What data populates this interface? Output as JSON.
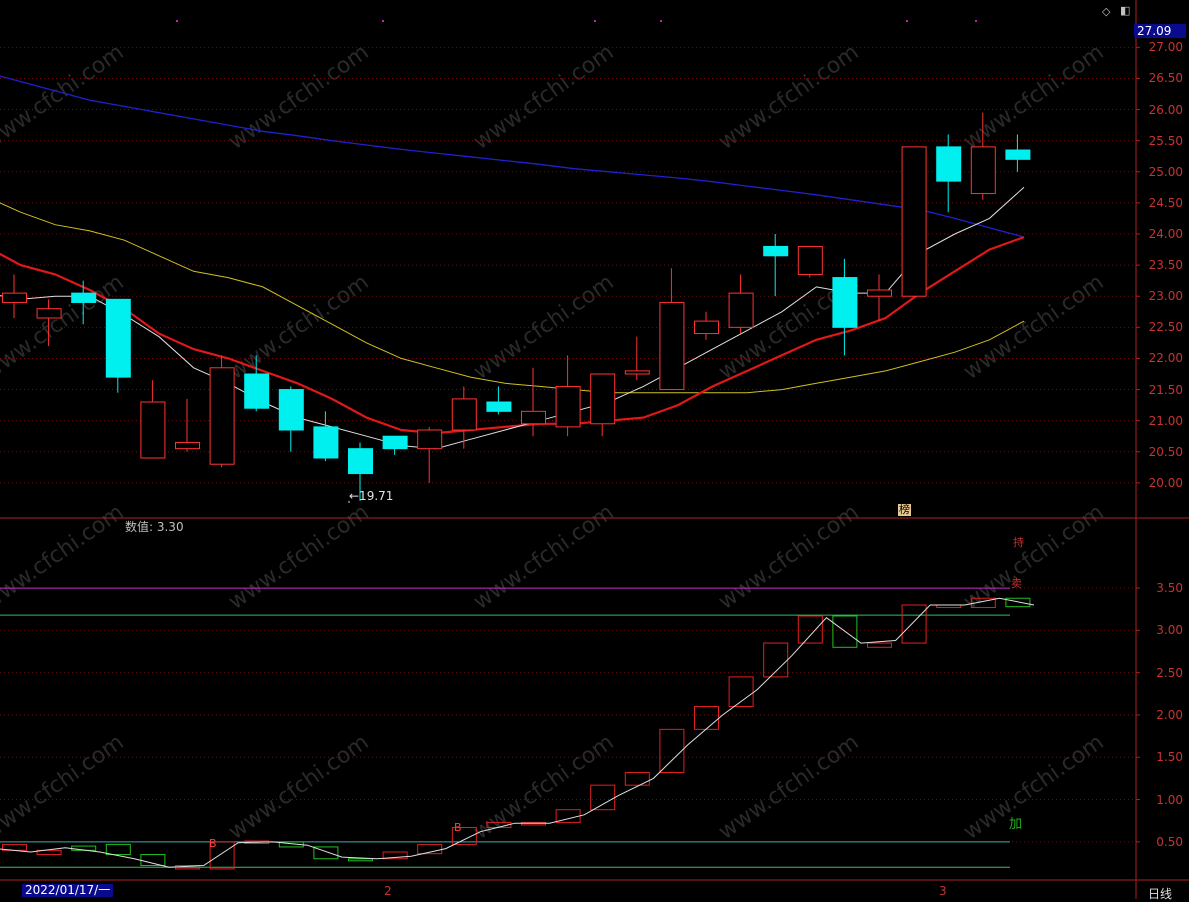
{
  "header": {
    "last_price": "27.09"
  },
  "main_axis": {
    "ticks": [
      "27.00",
      "26.50",
      "26.00",
      "25.50",
      "25.00",
      "24.50",
      "24.00",
      "23.50",
      "23.00",
      "22.50",
      "22.00",
      "21.50",
      "21.00",
      "20.50",
      "20.00"
    ]
  },
  "main_chart": {
    "ymin": 19.5,
    "ymax": 27.15,
    "candles": [
      [
        22.9,
        23.35,
        22.65,
        23.05
      ],
      [
        22.65,
        22.95,
        22.2,
        22.8
      ],
      [
        23.05,
        23.25,
        22.55,
        22.9
      ],
      [
        22.95,
        22.95,
        21.45,
        21.7
      ],
      [
        20.4,
        21.65,
        20.4,
        21.3
      ],
      [
        20.55,
        21.35,
        20.5,
        20.65
      ],
      [
        20.3,
        22.05,
        20.25,
        21.85
      ],
      [
        21.75,
        22.05,
        21.15,
        21.2
      ],
      [
        21.5,
        21.55,
        20.5,
        20.85
      ],
      [
        20.9,
        21.15,
        20.35,
        20.4
      ],
      [
        20.55,
        20.65,
        19.71,
        20.15
      ],
      [
        20.75,
        20.75,
        20.45,
        20.55
      ],
      [
        20.55,
        20.9,
        20.0,
        20.85
      ],
      [
        20.85,
        21.55,
        20.55,
        21.35
      ],
      [
        21.3,
        21.55,
        21.1,
        21.15
      ],
      [
        20.95,
        21.85,
        20.75,
        21.15
      ],
      [
        20.9,
        22.05,
        20.75,
        21.55
      ],
      [
        20.95,
        21.75,
        20.75,
        21.75
      ],
      [
        21.75,
        22.35,
        21.65,
        21.8
      ],
      [
        21.5,
        23.45,
        21.5,
        22.9
      ],
      [
        22.4,
        22.75,
        22.3,
        22.6
      ],
      [
        22.5,
        23.35,
        22.4,
        23.05
      ],
      [
        23.8,
        24.0,
        23.0,
        23.65
      ],
      [
        23.35,
        23.8,
        23.3,
        23.8
      ],
      [
        23.3,
        23.6,
        22.05,
        22.5
      ],
      [
        23.0,
        23.35,
        22.6,
        23.1
      ],
      [
        23.0,
        25.4,
        23.0,
        25.4
      ],
      [
        25.4,
        25.6,
        24.35,
        24.85
      ],
      [
        24.65,
        25.95,
        24.55,
        25.4
      ],
      [
        25.35,
        25.6,
        25.0,
        25.2
      ]
    ],
    "ma5": [
      23.05,
      22.95,
      23.0,
      23.0,
      22.7,
      22.35,
      21.85,
      21.6,
      21.3,
      21.05,
      20.9,
      20.75,
      20.6,
      20.55,
      20.7,
      20.85,
      21.0,
      21.15,
      21.3,
      21.55,
      21.85,
      22.15,
      22.45,
      22.75,
      23.15,
      23.05,
      23.05,
      23.7,
      24.0,
      24.25,
      24.75
    ],
    "ma10": [
      23.8,
      23.5,
      23.35,
      23.1,
      22.8,
      22.4,
      22.15,
      22.0,
      21.8,
      21.6,
      21.35,
      21.05,
      20.85,
      20.8,
      20.85,
      20.9,
      20.95,
      20.95,
      21.0,
      21.05,
      21.25,
      21.55,
      21.8,
      22.05,
      22.3,
      22.45,
      22.65,
      23.05,
      23.4,
      23.75,
      23.95
    ],
    "ma20": [
      24.6,
      24.35,
      24.15,
      24.05,
      23.9,
      23.65,
      23.4,
      23.3,
      23.15,
      22.85,
      22.55,
      22.25,
      22.0,
      21.85,
      21.7,
      21.6,
      21.55,
      21.5,
      21.45,
      21.45,
      21.45,
      21.45,
      21.45,
      21.5,
      21.6,
      21.7,
      21.8,
      21.95,
      22.1,
      22.3,
      22.6
    ],
    "ma60": [
      26.6,
      26.45,
      26.3,
      26.15,
      26.05,
      25.95,
      25.85,
      25.75,
      25.65,
      25.58,
      25.5,
      25.43,
      25.36,
      25.3,
      25.24,
      25.18,
      25.12,
      25.05,
      25.0,
      24.95,
      24.9,
      24.84,
      24.77,
      24.7,
      24.63,
      24.55,
      24.47,
      24.39,
      24.25,
      24.1,
      23.95
    ],
    "low_label": "←19.71",
    "badge": "榜"
  },
  "sub_chart": {
    "title": "数值: 3.30",
    "ymin": 0.12,
    "ymax": 3.95,
    "ticks": [
      "3.50",
      "3.00",
      "2.50",
      "2.00",
      "1.50",
      "1.00",
      "0.50"
    ],
    "upper_lines": [
      3.5,
      3.18
    ],
    "lower_lines": [
      0.5,
      0.2
    ],
    "boxes": [
      [
        0.4,
        0.47
      ],
      [
        0.35,
        0.4
      ],
      [
        0.4,
        0.45
      ],
      [
        0.35,
        0.47
      ],
      [
        0.22,
        0.35
      ],
      [
        0.18,
        0.22
      ],
      [
        0.18,
        0.5
      ],
      [
        0.48,
        0.51
      ],
      [
        0.44,
        0.5
      ],
      [
        0.3,
        0.44
      ],
      [
        0.28,
        0.3
      ],
      [
        0.3,
        0.38
      ],
      [
        0.36,
        0.47
      ],
      [
        0.47,
        0.67
      ],
      [
        0.67,
        0.73
      ],
      [
        0.7,
        0.73
      ],
      [
        0.73,
        0.88
      ],
      [
        0.88,
        1.17
      ],
      [
        1.17,
        1.32
      ],
      [
        1.32,
        1.83
      ],
      [
        1.83,
        2.1
      ],
      [
        2.1,
        2.45
      ],
      [
        2.45,
        2.85
      ],
      [
        2.85,
        3.17
      ],
      [
        2.8,
        3.17
      ],
      [
        2.8,
        2.85
      ],
      [
        2.85,
        3.3
      ],
      [
        3.27,
        3.3
      ],
      [
        3.27,
        3.38
      ],
      [
        3.28,
        3.38
      ]
    ],
    "line": [
      0.42,
      0.38,
      0.43,
      0.38,
      0.3,
      0.2,
      0.22,
      0.49,
      0.5,
      0.46,
      0.32,
      0.3,
      0.33,
      0.42,
      0.62,
      0.72,
      0.72,
      0.82,
      1.05,
      1.25,
      1.65,
      2.0,
      2.3,
      2.7,
      3.15,
      2.85,
      2.88,
      3.3,
      3.3,
      3.38,
      3.3
    ],
    "markers": [
      {
        "text": "B",
        "color": "#ff4040"
      },
      {
        "text": "B",
        "color": "#ff4040"
      }
    ],
    "right_labels": [
      {
        "text": "持",
        "color": "#c83232"
      },
      {
        "text": "卖",
        "color": "#c83232"
      },
      {
        "text": "加",
        "color": "#20b020"
      }
    ]
  },
  "footer": {
    "date": "2022/01/17/一",
    "month_ticks": [
      "2",
      "3"
    ],
    "period_label": "日线"
  }
}
